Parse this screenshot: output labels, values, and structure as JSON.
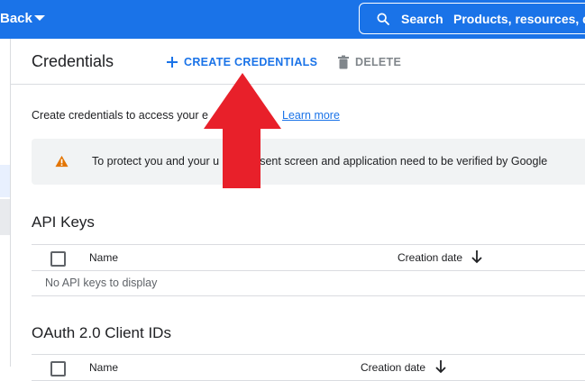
{
  "topbar": {
    "back_label": "Back",
    "search_label": "Search",
    "search_placeholder": "Products, resources, d"
  },
  "toolbar": {
    "title": "Credentials",
    "create_label": "CREATE CREDENTIALS",
    "delete_label": "DELETE"
  },
  "intro": {
    "text": "Create credentials to access your e",
    "link": "Learn more"
  },
  "warning": {
    "text": "To protect you and your u        our consent screen and application need to be verified by Google"
  },
  "api_keys": {
    "title": "API Keys",
    "col_name": "Name",
    "col_date": "Creation date",
    "empty": "No API keys to display"
  },
  "oauth": {
    "title": "OAuth 2.0 Client IDs",
    "col_name": "Name",
    "col_date": "Creation date"
  },
  "colors": {
    "brand": "#1a73e8",
    "annotation_arrow": "#e8202a",
    "warning": "#e37400"
  },
  "icons": [
    "chevron-down-icon",
    "search-icon",
    "plus-icon",
    "trash-icon",
    "warning-icon",
    "arrow-down-icon",
    "annotation-arrow"
  ]
}
